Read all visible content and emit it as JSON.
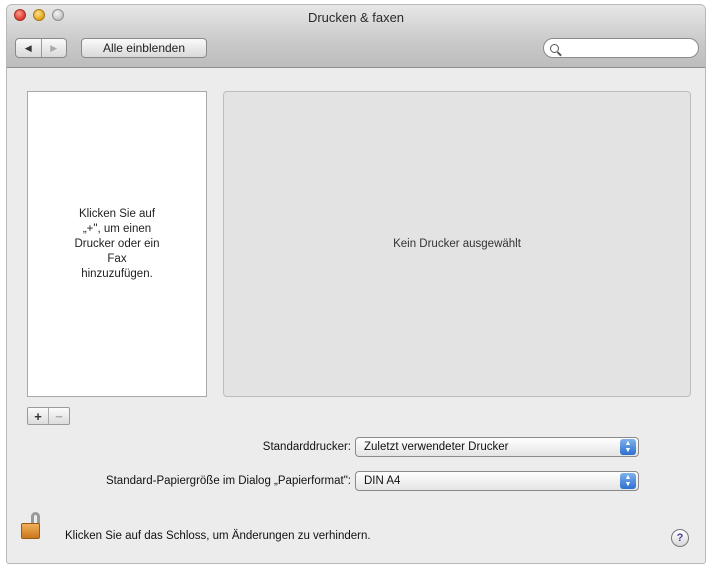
{
  "window": {
    "title": "Drucken & faxen"
  },
  "toolbar": {
    "back_glyph": "◀",
    "forward_glyph": "▶",
    "show_all_label": "Alle einblenden",
    "search_placeholder": "",
    "search_icon": "search-icon"
  },
  "printer_list": {
    "hint": "Klicken Sie auf\n„+\", um einen\nDrucker oder ein\nFax\nhinzuzufügen.",
    "add_label": "+",
    "remove_label": "−"
  },
  "detail": {
    "empty_text": "Kein Drucker ausgewählt"
  },
  "settings": {
    "default_printer_label": "Standarddrucker:",
    "default_printer_value": "Zuletzt verwendeter Drucker",
    "paper_size_label": "Standard-Papiergröße im Dialog „Papierformat\":",
    "paper_size_value": "DIN A4"
  },
  "footer": {
    "lock_text": "Klicken Sie auf das Schloss, um Änderungen zu verhindern.",
    "help_label": "?"
  },
  "colors": {
    "stepper_blue": "#2e6fd0",
    "lock_orange": "#e09a3e"
  }
}
